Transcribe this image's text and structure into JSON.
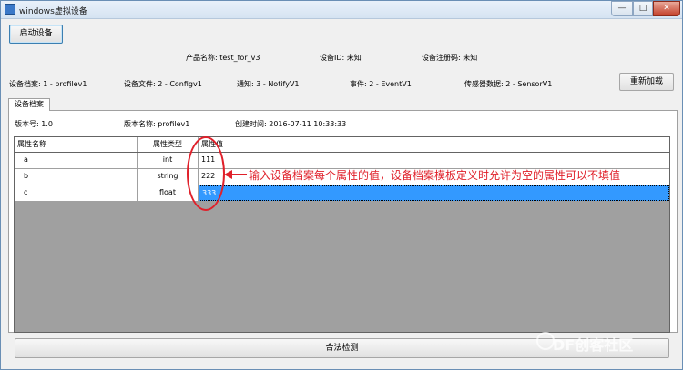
{
  "window": {
    "title": "windows虚拟设备",
    "minimize_label": "—",
    "maximize_label": "□",
    "close_label": "✕"
  },
  "toolbar": {
    "start_device_label": "启动设备"
  },
  "product_info": {
    "product_name_label": "产品名称:",
    "product_name_value": "test_for_v3",
    "device_id_label": "设备ID:",
    "device_id_value": "未知",
    "device_reg_label": "设备注册码:",
    "device_reg_value": "未知"
  },
  "config_bar": {
    "items": [
      {
        "label": "设备档案:",
        "value": "1 - profilev1"
      },
      {
        "label": "设备文件:",
        "value": "2 - Configv1"
      },
      {
        "label": "通知:",
        "value": "3 - NotifyV1"
      },
      {
        "label": "事件:",
        "value": "2 - EventV1"
      },
      {
        "label": "传感器数据:",
        "value": "2 - SensorV1"
      }
    ],
    "reload_label": "重新加载"
  },
  "tabs": [
    {
      "label": "设备档案",
      "active": true
    }
  ],
  "profile": {
    "version_label": "版本号:",
    "version_value": "1.0",
    "version_name_label": "版本名称:",
    "version_name_value": "profilev1",
    "created_label": "创建时间:",
    "created_value": "2016-07-11 10:33:33"
  },
  "grid": {
    "columns": [
      "属性名称",
      "属性类型",
      "属性值"
    ],
    "rows": [
      {
        "name": "a",
        "type": "int",
        "value": "111"
      },
      {
        "name": "b",
        "type": "string",
        "value": "222"
      },
      {
        "name": "c",
        "type": "float",
        "value": "333"
      }
    ],
    "selected_row": 2,
    "empty_area_color": "#a0a0a0",
    "selection_color": "#3399ff"
  },
  "annotation": {
    "text": "输入设备档案每个属性的值，设备档案模板定义时允许为空的属性可以不填值",
    "color": "#e0202a"
  },
  "footer": {
    "check_label": "合法检测"
  },
  "watermark": {
    "text": "DF创客社区"
  }
}
